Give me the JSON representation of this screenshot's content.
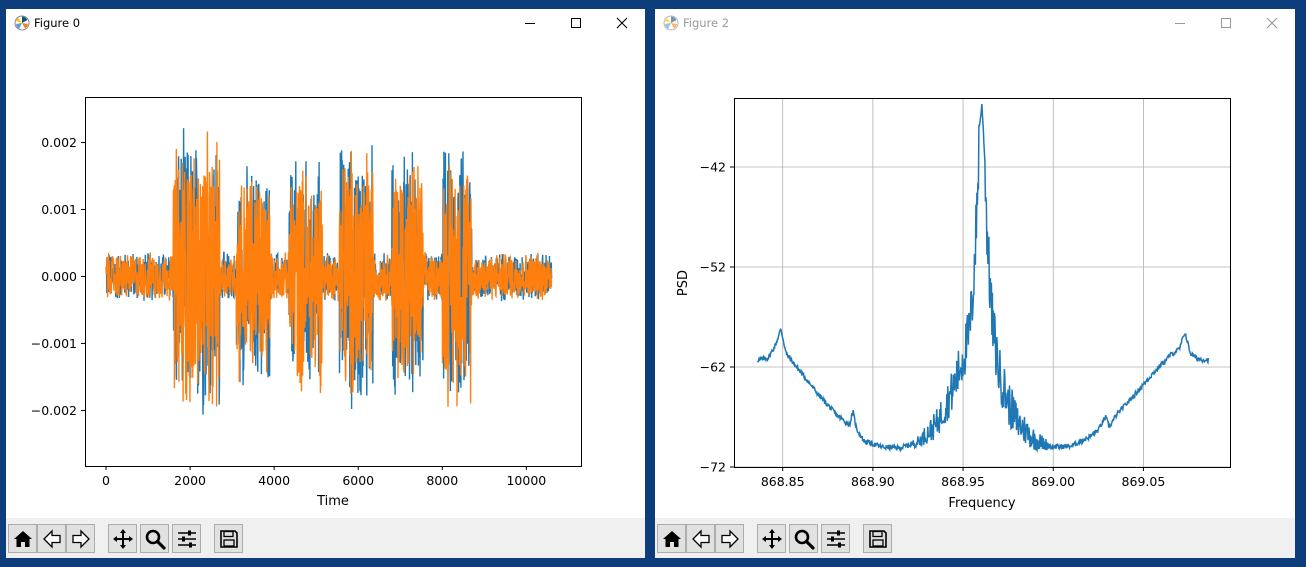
{
  "window0": {
    "title": "Figure 0",
    "chart_data": {
      "type": "line",
      "xlabel": "Time",
      "ylabel": "",
      "xlim": [
        -500,
        11300
      ],
      "ylim": [
        -0.00283,
        0.00268
      ],
      "xticks": [
        0,
        2000,
        4000,
        6000,
        8000,
        10000
      ],
      "xtick_labels": [
        "0",
        "2000",
        "4000",
        "6000",
        "8000",
        "10000"
      ],
      "yticks": [
        -0.002,
        -0.001,
        0.0,
        0.001,
        0.002
      ],
      "ytick_labels": [
        "−0.002",
        "−0.001",
        "0.000",
        "0.001",
        "0.002"
      ],
      "grid": false,
      "x_range": [
        0,
        10600
      ],
      "baseline_noise_amplitude": 0.0004,
      "bursts": [
        {
          "start": 1600,
          "end": 2700,
          "amplitude": 0.0023
        },
        {
          "start": 3100,
          "end": 3900,
          "amplitude": 0.0018
        },
        {
          "start": 4350,
          "end": 5150,
          "amplitude": 0.0019
        },
        {
          "start": 5550,
          "end": 6350,
          "amplitude": 0.0022
        },
        {
          "start": 6800,
          "end": 7550,
          "amplitude": 0.002
        },
        {
          "start": 8000,
          "end": 8700,
          "amplitude": 0.0021
        }
      ],
      "series": [
        {
          "color": "#1f77b4"
        },
        {
          "color": "#ff7f0e"
        }
      ]
    }
  },
  "window2": {
    "title": "Figure 2",
    "chart_data": {
      "type": "line",
      "xlabel": "Frequency",
      "ylabel": "PSD",
      "xlim": [
        868.823,
        869.098
      ],
      "ylim": [
        -72,
        -35.1
      ],
      "xticks": [
        868.85,
        868.9,
        868.95,
        869.0,
        869.05
      ],
      "xtick_labels": [
        "868.85",
        "868.90",
        "868.95",
        "869.00",
        "869.05"
      ],
      "yticks": [
        -72,
        -62,
        -52,
        -42
      ],
      "ytick_labels": [
        "−72",
        "−62",
        "−52",
        "−42"
      ],
      "grid": true,
      "series": [
        {
          "color": "#1f77b4",
          "x": [
            868.836,
            868.842,
            868.846,
            868.849,
            868.852,
            868.86,
            868.87,
            868.88,
            868.887,
            868.889,
            868.891,
            868.895,
            868.905,
            868.915,
            868.925,
            868.935,
            868.94,
            868.945,
            868.95,
            868.953,
            868.955,
            868.957,
            868.958,
            868.959,
            868.9605,
            868.962,
            868.963,
            868.964,
            868.966,
            868.968,
            868.97,
            868.975,
            868.98,
            868.99,
            869.0,
            869.01,
            869.02,
            869.025,
            869.029,
            869.031,
            869.035,
            869.045,
            869.055,
            869.065,
            869.07,
            869.073,
            869.076,
            869.08,
            869.086
          ],
          "y": [
            -61.3,
            -61.1,
            -59.8,
            -58.2,
            -60.7,
            -62.5,
            -64.8,
            -66.8,
            -67.8,
            -66.5,
            -68.2,
            -69.4,
            -70.0,
            -70.1,
            -69.5,
            -67.8,
            -66.0,
            -64.0,
            -61.0,
            -59.0,
            -56.0,
            -49.0,
            -45.0,
            -38.0,
            -35.8,
            -41.0,
            -47.0,
            -51.0,
            -57.0,
            -60.0,
            -62.5,
            -65.5,
            -67.5,
            -69.3,
            -70.0,
            -69.9,
            -69.0,
            -68.3,
            -67.0,
            -68.0,
            -66.8,
            -64.8,
            -62.7,
            -60.8,
            -60.2,
            -58.5,
            -60.6,
            -61.2,
            -61.3
          ]
        }
      ]
    }
  },
  "toolbar_icons": [
    "home-icon",
    "back-arrow-icon",
    "forward-arrow-icon",
    "pan-icon",
    "zoom-icon",
    "configure-subplots-icon",
    "save-icon"
  ]
}
